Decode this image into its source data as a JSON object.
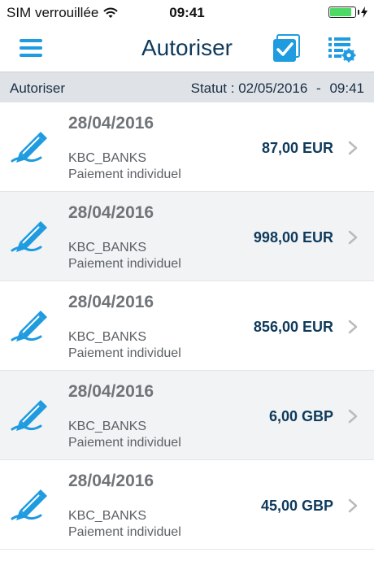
{
  "status_bar": {
    "carrier": "SIM verrouillée",
    "time": "09:41",
    "battery_level": 0.85,
    "battery_color": "#4cd964"
  },
  "nav_bar": {
    "title": "Autoriser",
    "menu_icon": "hamburger-menu-icon",
    "select_icon": "checkbox-select-all-icon",
    "settings_icon": "list-settings-icon",
    "accent_color": "#1f9be0"
  },
  "sub_header": {
    "label": "Autoriser",
    "status_label": "Statut :",
    "status_date": "02/05/2016",
    "status_time": "09:41"
  },
  "transactions": [
    {
      "date": "28/04/2016",
      "beneficiary": "KBC_BANKS",
      "type": "Paiement individuel",
      "amount": "87,00",
      "currency": "EUR",
      "icon": "sign-pen-icon"
    },
    {
      "date": "28/04/2016",
      "beneficiary": "KBC_BANKS",
      "type": "Paiement individuel",
      "amount": "998,00",
      "currency": "EUR",
      "icon": "sign-pen-icon"
    },
    {
      "date": "28/04/2016",
      "beneficiary": "KBC_BANKS",
      "type": "Paiement individuel",
      "amount": "856,00",
      "currency": "EUR",
      "icon": "sign-pen-icon"
    },
    {
      "date": "28/04/2016",
      "beneficiary": "KBC_BANKS",
      "type": "Paiement individuel",
      "amount": "6,00",
      "currency": "GBP",
      "icon": "sign-pen-icon"
    },
    {
      "date": "28/04/2016",
      "beneficiary": "KBC_BANKS",
      "type": "Paiement individuel",
      "amount": "45,00",
      "currency": "GBP",
      "icon": "sign-pen-icon"
    }
  ]
}
